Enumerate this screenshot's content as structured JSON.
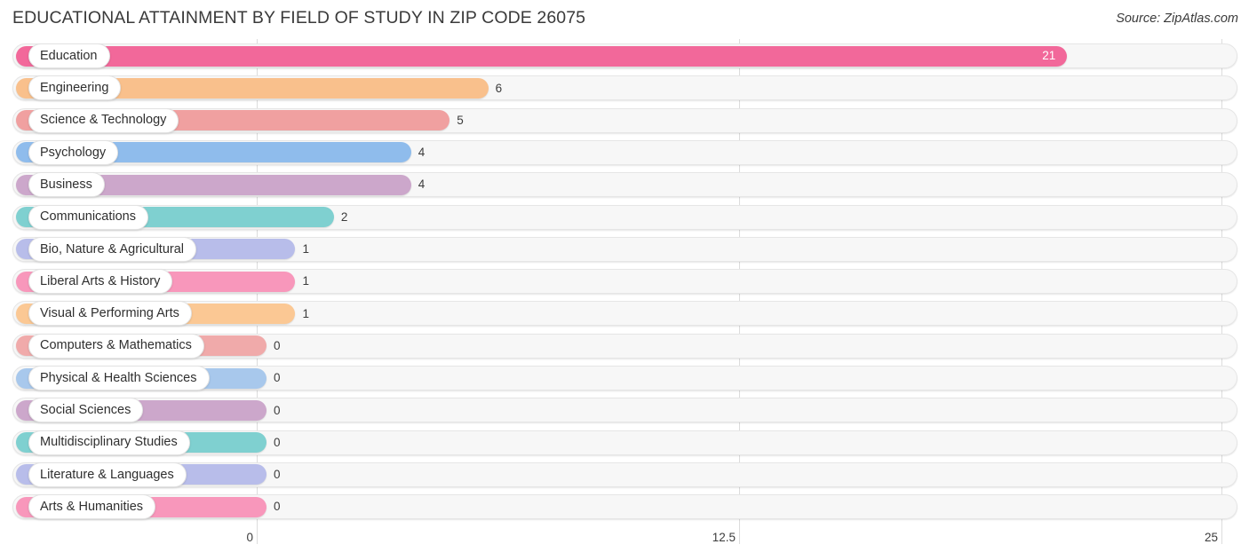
{
  "header": {
    "title": "EDUCATIONAL ATTAINMENT BY FIELD OF STUDY IN ZIP CODE 26075",
    "source": "Source: ZipAtlas.com"
  },
  "chart_data": {
    "type": "bar",
    "orientation": "horizontal",
    "title": "EDUCATIONAL ATTAINMENT BY FIELD OF STUDY IN ZIP CODE 26075",
    "subtitle": "",
    "xlabel": "",
    "ylabel": "",
    "xlim": [
      0,
      25
    ],
    "grid": true,
    "legend": "none",
    "xticks": [
      "0",
      "12.5",
      "25"
    ],
    "xtick_values": [
      0,
      12.5,
      25
    ],
    "categories": [
      "Education",
      "Engineering",
      "Science & Technology",
      "Psychology",
      "Business",
      "Communications",
      "Bio, Nature & Agricultural",
      "Liberal Arts & History",
      "Visual & Performing Arts",
      "Computers & Mathematics",
      "Physical & Health Sciences",
      "Social Sciences",
      "Multidisciplinary Studies",
      "Literature & Languages",
      "Arts & Humanities"
    ],
    "values": [
      21,
      6,
      5,
      4,
      4,
      2,
      1,
      1,
      1,
      0,
      0,
      0,
      0,
      0,
      0
    ],
    "value_labels": [
      "21",
      "6",
      "5",
      "4",
      "4",
      "2",
      "1",
      "1",
      "1",
      "0",
      "0",
      "0",
      "0",
      "0",
      "0"
    ],
    "bar_colors": [
      "#f2689a",
      "#f9c08c",
      "#f0a0a0",
      "#8fbcec",
      "#cca7cb",
      "#7fd0d0",
      "#b8bdea",
      "#f897bb",
      "#fbc894",
      "#f0aaaa",
      "#a8c8ec",
      "#cca7cb",
      "#7fd0d0",
      "#b8bdea",
      "#f897bb"
    ]
  },
  "colors": {
    "track": "#f7f7f7",
    "track_border": "#e6e6e6",
    "gridline": "#dcdcdc",
    "text": "#3a3a3a",
    "pill_background": "#ffffff"
  }
}
